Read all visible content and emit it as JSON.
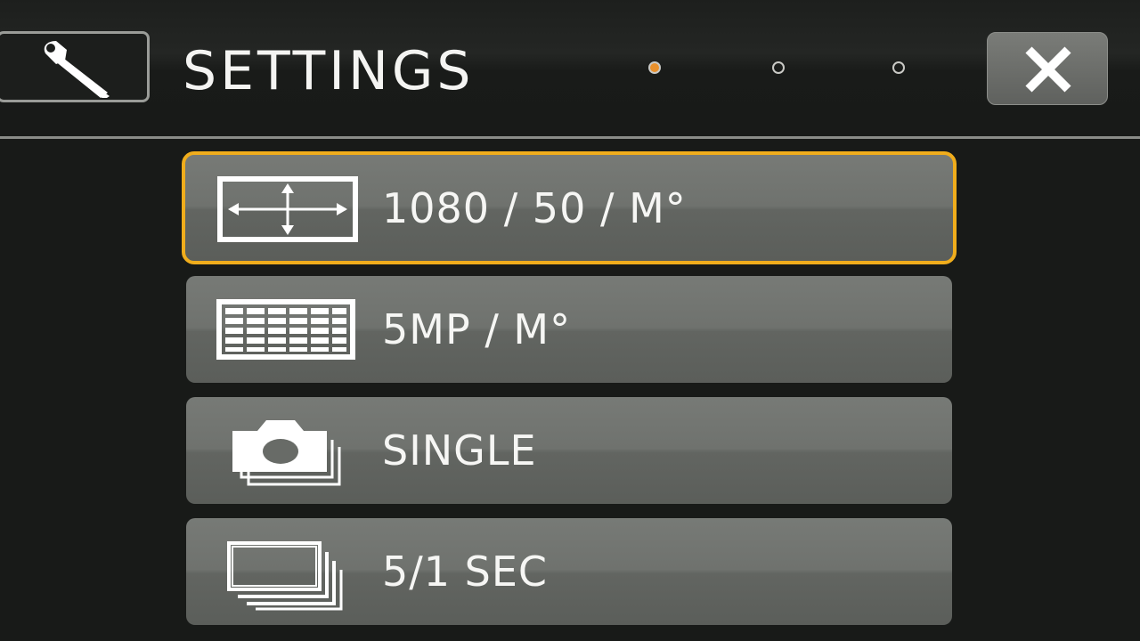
{
  "header": {
    "title": "SETTINGS",
    "tool_icon": "wrench-icon",
    "close_icon": "close-icon",
    "page_indicator": {
      "total": 3,
      "active": 1,
      "active_color": "#e8902c"
    }
  },
  "menu": {
    "items": [
      {
        "label": "1080 / 50 / M°",
        "icon": "video-resolution-icon",
        "selected": true
      },
      {
        "label": "5MP / M°",
        "icon": "photo-resolution-icon",
        "selected": false
      },
      {
        "label": "SINGLE",
        "icon": "camera-single-icon",
        "selected": false
      },
      {
        "label": "5/1 SEC",
        "icon": "burst-frames-icon",
        "selected": false
      }
    ]
  },
  "colors": {
    "background": "#181a18",
    "selection_border": "#f0ad1c",
    "text": "#f6f6f4"
  }
}
